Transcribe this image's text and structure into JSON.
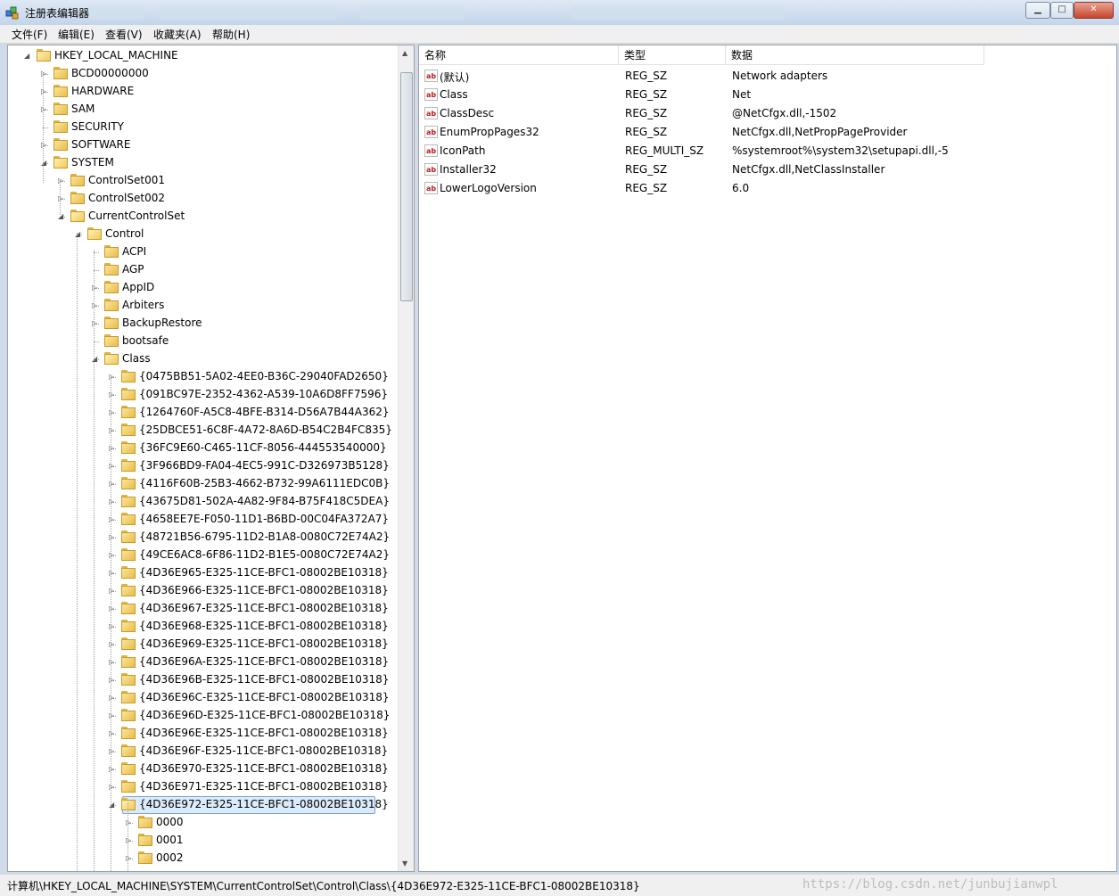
{
  "window": {
    "title": "注册表编辑器",
    "minimize_label": "▁",
    "maximize_label": "□",
    "close_label": "✕"
  },
  "menu": [
    "文件(F)",
    "编辑(E)",
    "查看(V)",
    "收藏夹(A)",
    "帮助(H)"
  ],
  "tree": [
    {
      "label": "HKEY_LOCAL_MACHINE",
      "depth": 0,
      "state": "expanded"
    },
    {
      "label": "BCD00000000",
      "depth": 1,
      "state": "collapsed"
    },
    {
      "label": "HARDWARE",
      "depth": 1,
      "state": "collapsed"
    },
    {
      "label": "SAM",
      "depth": 1,
      "state": "collapsed"
    },
    {
      "label": "SECURITY",
      "depth": 1,
      "state": "leaf"
    },
    {
      "label": "SOFTWARE",
      "depth": 1,
      "state": "collapsed"
    },
    {
      "label": "SYSTEM",
      "depth": 1,
      "state": "expanded"
    },
    {
      "label": "ControlSet001",
      "depth": 2,
      "state": "collapsed"
    },
    {
      "label": "ControlSet002",
      "depth": 2,
      "state": "collapsed"
    },
    {
      "label": "CurrentControlSet",
      "depth": 2,
      "state": "expanded"
    },
    {
      "label": "Control",
      "depth": 3,
      "state": "expanded"
    },
    {
      "label": "ACPI",
      "depth": 4,
      "state": "leaf"
    },
    {
      "label": "AGP",
      "depth": 4,
      "state": "leaf"
    },
    {
      "label": "AppID",
      "depth": 4,
      "state": "collapsed"
    },
    {
      "label": "Arbiters",
      "depth": 4,
      "state": "collapsed"
    },
    {
      "label": "BackupRestore",
      "depth": 4,
      "state": "collapsed"
    },
    {
      "label": "bootsafe",
      "depth": 4,
      "state": "leaf"
    },
    {
      "label": "Class",
      "depth": 4,
      "state": "expanded"
    },
    {
      "label": "{0475BB51-5A02-4EE0-B36C-29040FAD2650}",
      "depth": 5,
      "state": "collapsed"
    },
    {
      "label": "{091BC97E-2352-4362-A539-10A6D8FF7596}",
      "depth": 5,
      "state": "collapsed"
    },
    {
      "label": "{1264760F-A5C8-4BFE-B314-D56A7B44A362}",
      "depth": 5,
      "state": "collapsed"
    },
    {
      "label": "{25DBCE51-6C8F-4A72-8A6D-B54C2B4FC835}",
      "depth": 5,
      "state": "collapsed"
    },
    {
      "label": "{36FC9E60-C465-11CF-8056-444553540000}",
      "depth": 5,
      "state": "collapsed"
    },
    {
      "label": "{3F966BD9-FA04-4EC5-991C-D326973B5128}",
      "depth": 5,
      "state": "collapsed"
    },
    {
      "label": "{4116F60B-25B3-4662-B732-99A6111EDC0B}",
      "depth": 5,
      "state": "collapsed"
    },
    {
      "label": "{43675D81-502A-4A82-9F84-B75F418C5DEA}",
      "depth": 5,
      "state": "collapsed"
    },
    {
      "label": "{4658EE7E-F050-11D1-B6BD-00C04FA372A7}",
      "depth": 5,
      "state": "collapsed"
    },
    {
      "label": "{48721B56-6795-11D2-B1A8-0080C72E74A2}",
      "depth": 5,
      "state": "collapsed"
    },
    {
      "label": "{49CE6AC8-6F86-11D2-B1E5-0080C72E74A2}",
      "depth": 5,
      "state": "collapsed"
    },
    {
      "label": "{4D36E965-E325-11CE-BFC1-08002BE10318}",
      "depth": 5,
      "state": "collapsed"
    },
    {
      "label": "{4D36E966-E325-11CE-BFC1-08002BE10318}",
      "depth": 5,
      "state": "collapsed"
    },
    {
      "label": "{4D36E967-E325-11CE-BFC1-08002BE10318}",
      "depth": 5,
      "state": "collapsed"
    },
    {
      "label": "{4D36E968-E325-11CE-BFC1-08002BE10318}",
      "depth": 5,
      "state": "collapsed"
    },
    {
      "label": "{4D36E969-E325-11CE-BFC1-08002BE10318}",
      "depth": 5,
      "state": "collapsed"
    },
    {
      "label": "{4D36E96A-E325-11CE-BFC1-08002BE10318}",
      "depth": 5,
      "state": "collapsed"
    },
    {
      "label": "{4D36E96B-E325-11CE-BFC1-08002BE10318}",
      "depth": 5,
      "state": "collapsed"
    },
    {
      "label": "{4D36E96C-E325-11CE-BFC1-08002BE10318}",
      "depth": 5,
      "state": "collapsed"
    },
    {
      "label": "{4D36E96D-E325-11CE-BFC1-08002BE10318}",
      "depth": 5,
      "state": "collapsed"
    },
    {
      "label": "{4D36E96E-E325-11CE-BFC1-08002BE10318}",
      "depth": 5,
      "state": "collapsed"
    },
    {
      "label": "{4D36E96F-E325-11CE-BFC1-08002BE10318}",
      "depth": 5,
      "state": "collapsed"
    },
    {
      "label": "{4D36E970-E325-11CE-BFC1-08002BE10318}",
      "depth": 5,
      "state": "collapsed"
    },
    {
      "label": "{4D36E971-E325-11CE-BFC1-08002BE10318}",
      "depth": 5,
      "state": "collapsed"
    },
    {
      "label": "{4D36E972-E325-11CE-BFC1-08002BE10318}",
      "depth": 5,
      "state": "expanded",
      "selected": true
    },
    {
      "label": "0000",
      "depth": 6,
      "state": "collapsed"
    },
    {
      "label": "0001",
      "depth": 6,
      "state": "collapsed"
    },
    {
      "label": "0002",
      "depth": 6,
      "state": "collapsed"
    }
  ],
  "columns": [
    "名称",
    "类型",
    "数据"
  ],
  "values": [
    {
      "name": "(默认)",
      "type": "REG_SZ",
      "data": "Network adapters"
    },
    {
      "name": "Class",
      "type": "REG_SZ",
      "data": "Net"
    },
    {
      "name": "ClassDesc",
      "type": "REG_SZ",
      "data": "@NetCfgx.dll,-1502"
    },
    {
      "name": "EnumPropPages32",
      "type": "REG_SZ",
      "data": "NetCfgx.dll,NetPropPageProvider"
    },
    {
      "name": "IconPath",
      "type": "REG_MULTI_SZ",
      "data": "%systemroot%\\system32\\setupapi.dll,-5"
    },
    {
      "name": "Installer32",
      "type": "REG_SZ",
      "data": "NetCfgx.dll,NetClassInstaller"
    },
    {
      "name": "LowerLogoVersion",
      "type": "REG_SZ",
      "data": "6.0"
    }
  ],
  "value_icon_text": "ab",
  "status": "计算机\\HKEY_LOCAL_MACHINE\\SYSTEM\\CurrentControlSet\\Control\\Class\\{4D36E972-E325-11CE-BFC1-08002BE10318}",
  "watermark": "https://blog.csdn.net/junbujianwpl"
}
